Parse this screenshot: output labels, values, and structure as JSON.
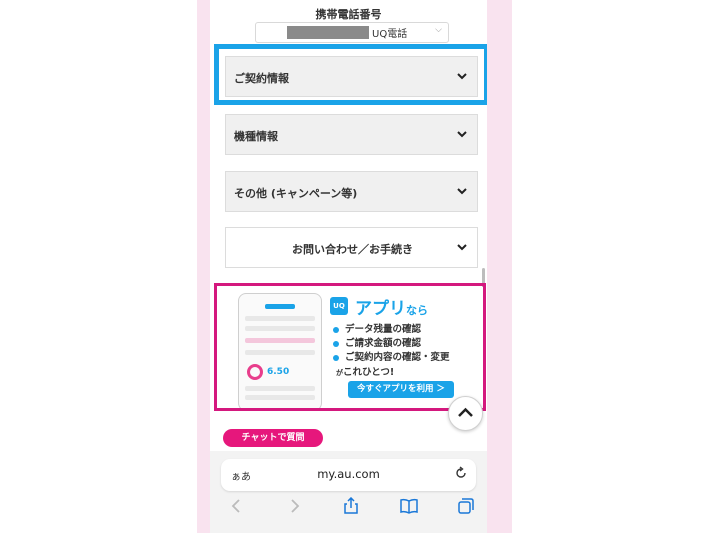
{
  "account": {
    "phone_label": "携帯電話番号",
    "carrier": "UQ電話"
  },
  "menu": {
    "items": [
      {
        "label": "ご契約情報"
      },
      {
        "label": "機種情報"
      },
      {
        "label": "その他 (キャンペーン等)"
      },
      {
        "label": "お問い合わせ／お手続き"
      }
    ]
  },
  "banner": {
    "logo": "UQ",
    "title": "アプリ",
    "title_suffix": "なら",
    "features": [
      "データ残量の確認",
      "ご請求金額の確認",
      "ご契約内容の確認・変更"
    ],
    "tagline_prefix": "が",
    "tagline": "これひとつ!",
    "button": "今すぐアプリを利用 ＞",
    "mock_amount": "6.50"
  },
  "chat": {
    "label": "チャットで質問"
  },
  "browser": {
    "text_size": "ぁあ",
    "url": "my.au.com"
  },
  "colors": {
    "highlight_blue": "#1aa3e8",
    "highlight_pink": "#d4187e",
    "brand_blue": "#1aa3e8",
    "chat_pink": "#e6177c"
  }
}
